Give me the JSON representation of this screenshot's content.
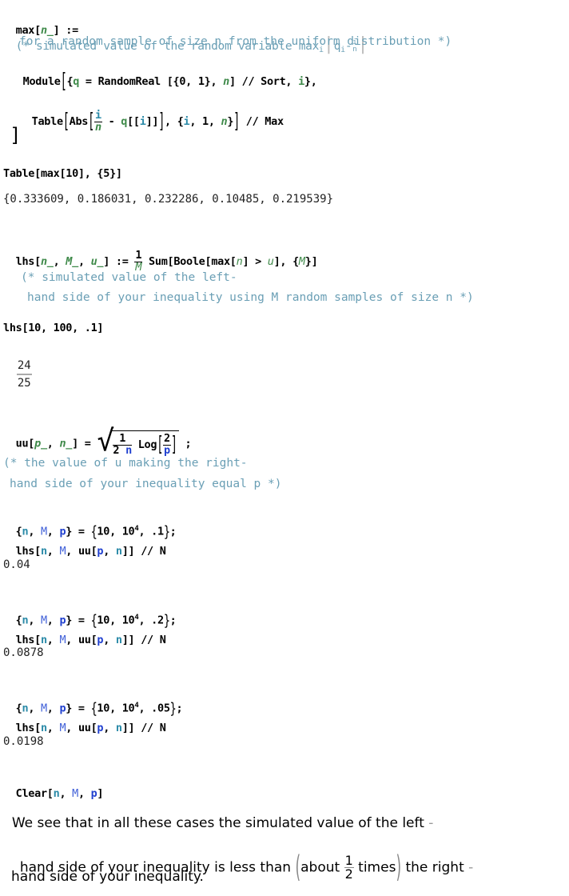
{
  "cells": {
    "max_def": {
      "head": "max",
      "arg": "n_",
      "op": ":=",
      "comment_line1": "(* simulated value of the random variable max",
      "comment_sub": "i",
      "comment_q": "q",
      "comment_frac_num": "i",
      "comment_frac_den": "n",
      "comment_line2": "for a random sample of size n from the uniform distribution *)",
      "module_line": [
        "Module",
        "{",
        "q",
        " = RandomReal [{0, 1}, ",
        "n",
        "] // Sort, ",
        "i",
        "},"
      ],
      "table_line": {
        "head": "Table",
        "abs": "Abs",
        "frac_num": "i",
        "frac_den": "n",
        "mid": " - ",
        "q": "q",
        "part_open": "[[",
        "i": "i",
        "part_close": "]]",
        "iter_open": ", {",
        "iter_i": "i",
        "iter_mid": ", 1, ",
        "iter_n": "n",
        "iter_close": "}",
        "postfix": " // Max"
      },
      "close_bracket": "]"
    },
    "table_call": {
      "input": "Table[max[10], {5}]",
      "output": "{0.333609, 0.186031, 0.232286, 0.10485, 0.219539}"
    },
    "lhs_def": {
      "head": "lhs[",
      "args": [
        "n_",
        "M_",
        "u_"
      ],
      "op": "] := ",
      "frac_num": "1",
      "frac_den": "M",
      "body_a": " Sum[Boole[max[",
      "body_n": "n",
      "body_b": "] > ",
      "body_u": "u",
      "body_c": "], {",
      "body_M": "M",
      "body_d": "}]",
      "comment_line1": "(* simulated value of the left-",
      "comment_line2": "hand side of your inequality using M random samples of size n *)"
    },
    "lhs_call": {
      "input": "lhs[10, 100, .1]",
      "output_num": "24",
      "output_den": "25"
    },
    "uu_def": {
      "head": "uu[",
      "args": [
        "p_",
        "n_"
      ],
      "op": "] = ",
      "frac1_num": "1",
      "frac1_den_a": "2 ",
      "frac1_den_n": "n",
      "log": "Log",
      "frac2_num": "2",
      "frac2_den": "p",
      "end": ";",
      "comment_line1": "(* the value of u making the right-",
      "comment_line2": "hand side of your inequality equal p *)"
    },
    "runs": [
      {
        "n": "10",
        "M_base": "10",
        "M_exp": "4",
        "p": ".1",
        "output": "0.04"
      },
      {
        "n": "10",
        "M_base": "10",
        "M_exp": "4",
        "p": ".2",
        "output": "0.0878"
      },
      {
        "n": "10",
        "M_base": "10",
        "M_exp": "4",
        "p": ".05",
        "output": "0.0198"
      }
    ],
    "run_call": {
      "lhs": "lhs[",
      "n": "n",
      "M": "M",
      "uu": "uu[",
      "p": "p",
      "close": "]] // N"
    },
    "clear": {
      "head": "Clear[",
      "n": "n",
      "M": "M",
      "p": "p",
      "close": "]"
    },
    "conclusion": {
      "line1": "We see that in all these cases the simulated value of the left",
      "line2_a": "hand side of your inequality is less than",
      "about": "about",
      "frac_num": "1",
      "frac_den": "2",
      "times": "times",
      "line2_b": "the right",
      "line3": "hand side of your inequality."
    }
  }
}
